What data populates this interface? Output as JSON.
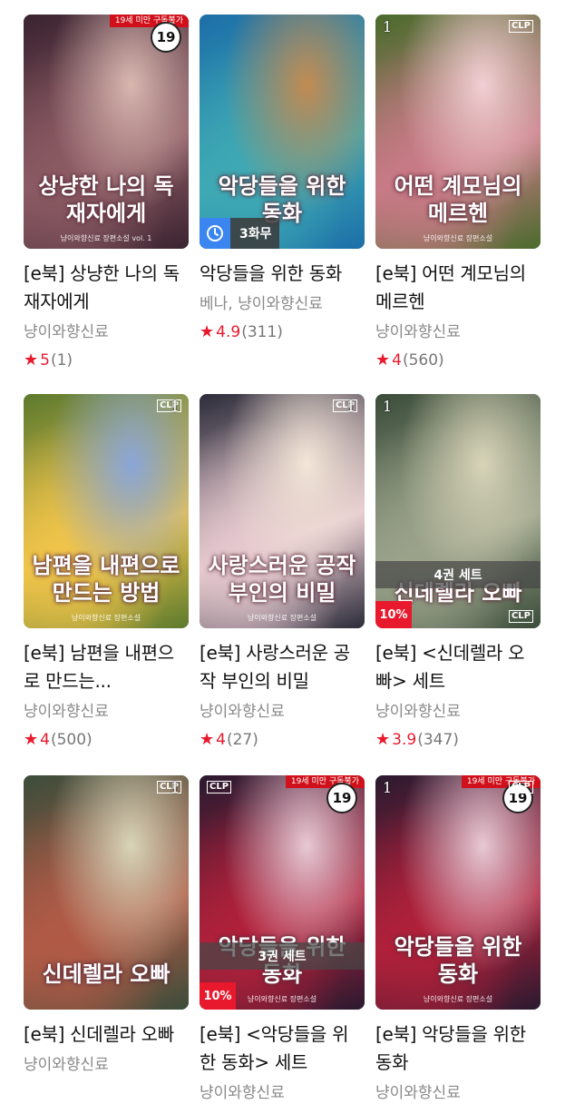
{
  "books": [
    {
      "title": "[e북] 상냥한 나의 독재자에게",
      "author": "냥이와향신료",
      "score": "5",
      "count": "(1)",
      "cover_title": "상냥한 나의 독재자에게",
      "cover_sub": "냥이와향신료 장편소설 vol. 1",
      "age_badge": "19",
      "restrict_text": "19세 미만 구독불가",
      "colors": [
        "#3a2330",
        "#8b5a63",
        "#d9b7b0"
      ]
    },
    {
      "title": "악당들을 위한 동화",
      "author": "베나, 냥이와향신료",
      "score": "4.9",
      "count": "(311)",
      "cover_title": "악당들을 위한 동화",
      "wait_text": "3화무",
      "colors": [
        "#1c6fa8",
        "#3ea9b4",
        "#c28b52"
      ]
    },
    {
      "title": "[e북] 어떤 계모님의 메르헨",
      "author": "냥이와향신료",
      "score": "4",
      "count": "(560)",
      "cover_title": "어떤 계모님의 메르헨",
      "cover_sub": "냥이와향신료 장편소설",
      "vol": "1",
      "logo": "CLP",
      "colors": [
        "#4a6b2c",
        "#c87a86",
        "#f2cfd3"
      ]
    },
    {
      "title": "[e북] 남편을 내편으로 만드는...",
      "author": "냥이와향신료",
      "score": "4",
      "count": "(500)",
      "cover_title": "남편을 내편으로 만드는 방법",
      "cover_sub": "냥이와향신료 장편소설",
      "vol": "1",
      "logo": "CLP",
      "colors": [
        "#5c7a2e",
        "#f0c44a",
        "#8aa6d8"
      ]
    },
    {
      "title": "[e북] 사랑스러운 공작 부인의 비밀",
      "author": "냥이와향신료",
      "score": "4",
      "count": "(27)",
      "cover_title": "사랑스러운 공작 부인의 비밀",
      "cover_sub": "냥이와향신료 장편소설",
      "vol": "1",
      "logo": "CLP",
      "colors": [
        "#2c2c3a",
        "#e6c9cf",
        "#f4e6d8"
      ]
    },
    {
      "title": "[e북] <신데렐라 오빠> 세트",
      "author": "냥이와향신료",
      "score": "3.9",
      "count": "(347)",
      "cover_title": "신데렐라 오빠",
      "vol": "1",
      "logo": "CLP",
      "set_text": "4권 세트",
      "discount": "10%",
      "colors": [
        "#3b4d3a",
        "#9aa28a",
        "#d8d4b8"
      ]
    },
    {
      "title": "[e북] 신데렐라 오빠",
      "author": "냥이와향신료",
      "cover_title": "신데렐라 오빠",
      "vol": "1",
      "logo": "CLP",
      "colors": [
        "#3b4d3a",
        "#b05a46",
        "#d8d4b8"
      ]
    },
    {
      "title": "[e북] <악당들을 위한 동화> 세트",
      "author": "냥이와향신료",
      "cover_title": "악당들을 위한 동화",
      "cover_sub": "냥이와향신료 장편소설",
      "age_badge": "19",
      "restrict_text": "19세 미만 구독불가",
      "logo": "CLP",
      "set_text": "3권 세트",
      "discount": "10%",
      "colors": [
        "#2a1a30",
        "#b0203a",
        "#e8c8d4"
      ]
    },
    {
      "title": "[e북] 악당들을 위한 동화",
      "author": "냥이와향신료",
      "cover_title": "악당들을 위한 동화",
      "cover_sub": "냥이와향신료 장편소설",
      "age_badge": "19",
      "restrict_text": "19세 미만 구독불가",
      "logo": "CLP",
      "vol": "1",
      "colors": [
        "#2a1a30",
        "#b0203a",
        "#e8c8d4"
      ]
    }
  ]
}
